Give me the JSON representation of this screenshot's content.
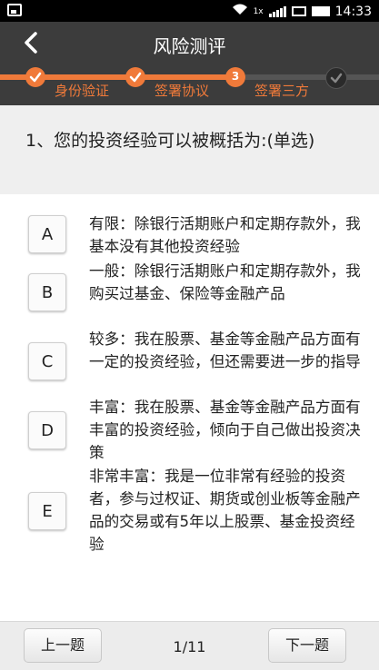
{
  "status_bar": {
    "time": "14:33",
    "icons": [
      "image-icon",
      "wifi-icon",
      "signal-icon",
      "mail-icon",
      "battery-icon"
    ],
    "network": "1x"
  },
  "header": {
    "title": "风险测评"
  },
  "progress": {
    "steps": [
      {
        "label": "身份验证",
        "state": "done"
      },
      {
        "label": "签署协议",
        "state": "done"
      },
      {
        "label": "签署三方",
        "state": "current",
        "number": "3"
      },
      {
        "label": "",
        "state": "pending"
      }
    ],
    "colors": {
      "active": "#f07a3a",
      "inactive": "#555555"
    }
  },
  "question": {
    "text": "1、您的投资经验可以被概括为:(单选)"
  },
  "options": [
    {
      "key": "A",
      "text": "有限：除银行活期账户和定期存款外，我基本没有其他投资经验"
    },
    {
      "key": "B",
      "text": "一般：除银行活期账户和定期存款外，我购买过基金、保险等金融产品"
    },
    {
      "key": "C",
      "text": "较多：我在股票、基金等金融产品方面有一定的投资经验，但还需要进一步的指导"
    },
    {
      "key": "D",
      "text": "丰富：我在股票、基金等金融产品方面有丰富的投资经验，倾向于自己做出投资决策"
    },
    {
      "key": "E",
      "text": "非常丰富：我是一位非常有经验的投资者，参与过权证、期货或创业板等金融产品的交易或有5年以上股票、基金投资经验"
    }
  ],
  "footer": {
    "prev_label": "上一题",
    "next_label": "下一题",
    "page": "1/11"
  }
}
